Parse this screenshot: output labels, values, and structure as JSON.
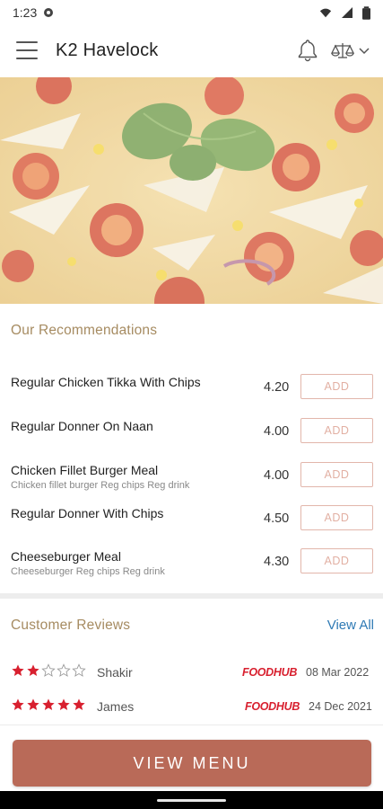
{
  "status_bar": {
    "time": "1:23"
  },
  "app_bar": {
    "title": "K2 Havelock"
  },
  "recommendations": {
    "title": "Our Recommendations",
    "add_label": "ADD",
    "items": [
      {
        "name": "Regular Chicken Tikka With Chips",
        "desc": "",
        "price": "4.20"
      },
      {
        "name": "Regular Donner On Naan",
        "desc": "",
        "price": "4.00"
      },
      {
        "name": "Chicken Fillet Burger Meal",
        "desc": "Chicken fillet burger Reg chips Reg drink",
        "price": "4.00"
      },
      {
        "name": "Regular Donner With Chips",
        "desc": "",
        "price": "4.50"
      },
      {
        "name": "Cheeseburger Meal",
        "desc": "Cheeseburger Reg chips Reg drink",
        "price": "4.30"
      }
    ]
  },
  "reviews": {
    "title": "Customer Reviews",
    "view_all": "View All",
    "items": [
      {
        "name": "Shakir",
        "rating": 2,
        "source": "FOODHUB",
        "date": "08 Mar 2022"
      },
      {
        "name": "James",
        "rating": 5,
        "source": "FOODHUB",
        "date": "24 Dec 2021"
      }
    ]
  },
  "bottom": {
    "view_menu": "VIEW MENU"
  },
  "colors": {
    "accent": "#b96a58",
    "section_title": "#a68b61",
    "link": "#2f7ab5",
    "star": "#d8202f"
  },
  "icons": [
    "notification-dot-icon",
    "wifi-icon",
    "signal-icon",
    "battery-icon",
    "menu-icon",
    "bell-icon",
    "scale-icon",
    "chevron-down-icon",
    "star-icon"
  ]
}
